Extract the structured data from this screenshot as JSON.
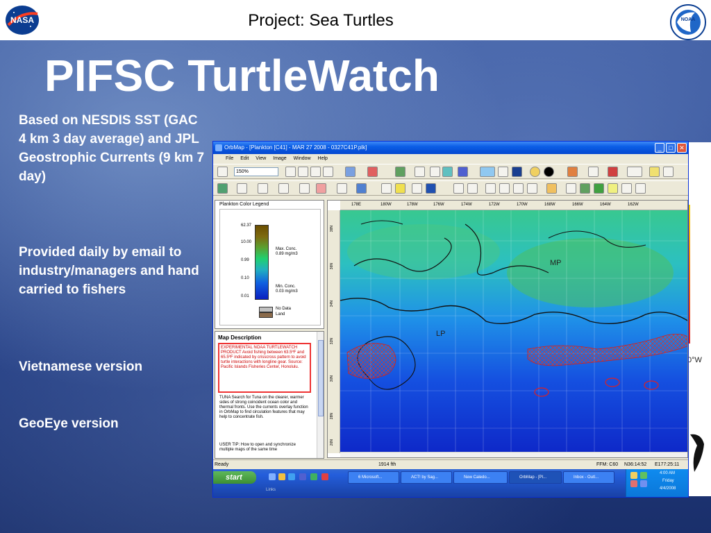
{
  "header": {
    "title": "Project: Sea Turtles",
    "left_logo": "NASA",
    "right_logo": "NOAA"
  },
  "slide": {
    "title": "PIFSC TurtleWatch",
    "bullets": [
      "Based on NESDIS SST (GAC 4 km 3 day average) and JPL Geostrophic Currents (9 km 7 day)",
      "Provided daily by email to industry/managers and hand carried to fishers",
      "Vietnamese version",
      "GeoEye version"
    ]
  },
  "app": {
    "title": "OrbMap - [Plankton [C41] - MAR 27 2008 - 0327C41P.plk]",
    "menu": [
      "File",
      "Edit",
      "View",
      "Image",
      "Window",
      "Help"
    ],
    "zoom": "150%",
    "legend": {
      "title": "Plankton Color Legend",
      "ticks": [
        "62.37",
        "10.00",
        "0.99",
        "0.10",
        "0.01"
      ],
      "max_label": "Max. Conc.",
      "max_value": "0.89 mg/m3",
      "min_label": "Min. Conc.",
      "min_value": "0.03 mg/m3",
      "nodata": "No Data",
      "land": "Land"
    },
    "description": {
      "heading": "Map Description",
      "box_text": "EXPERIMENTAL NOAA TURTLEWATCH PRODUCT Avoid fishing between 63.5ºF and 65.5ºF indicated by crisscross pattern to avoid turtle interactions with longline gear. Source: Pacific Islands Fisheries Center, Honolulu.",
      "tuna": "TUNA Search for Tuna on the clearer, warmer sides of strong coincident ocean color and thermal fronts. Use the currents overlay function in OrbMap to find circulation features that may help to concentrate fish.",
      "tip": "USER TIP: How to open and synchronize multiple maps of the same time"
    },
    "ruler_top": [
      "178E",
      "180W",
      "178W",
      "176W",
      "174W",
      "172W",
      "170W",
      "168W",
      "166W",
      "164W",
      "162W"
    ],
    "ruler_left": [
      "38N",
      "36N",
      "34N",
      "32N",
      "30N",
      "28N",
      "26N"
    ],
    "map_labels": {
      "mp": "MP",
      "lp": "LP"
    },
    "status": {
      "ready": "Ready",
      "depth": "1914 fth",
      "ffm": "FFM: C60",
      "lat": "N36:14:52",
      "lon": "E177:25:11"
    },
    "taskbar": {
      "start": "start",
      "items": [
        "6 Microsoft...",
        "ACT! by Sag...",
        "New Caledo...",
        "OrbMap - [Pl...",
        "Inbox - Outl..."
      ],
      "time": "4:00 AM",
      "day": "Friday",
      "date": "4/4/2008",
      "links": "Links"
    }
  },
  "background_window": {
    "label": "0°W"
  },
  "colors": {
    "title_blue": "#0548d0",
    "frontal_red": "#e02020",
    "ocean_dark": "#1a2f6b"
  }
}
